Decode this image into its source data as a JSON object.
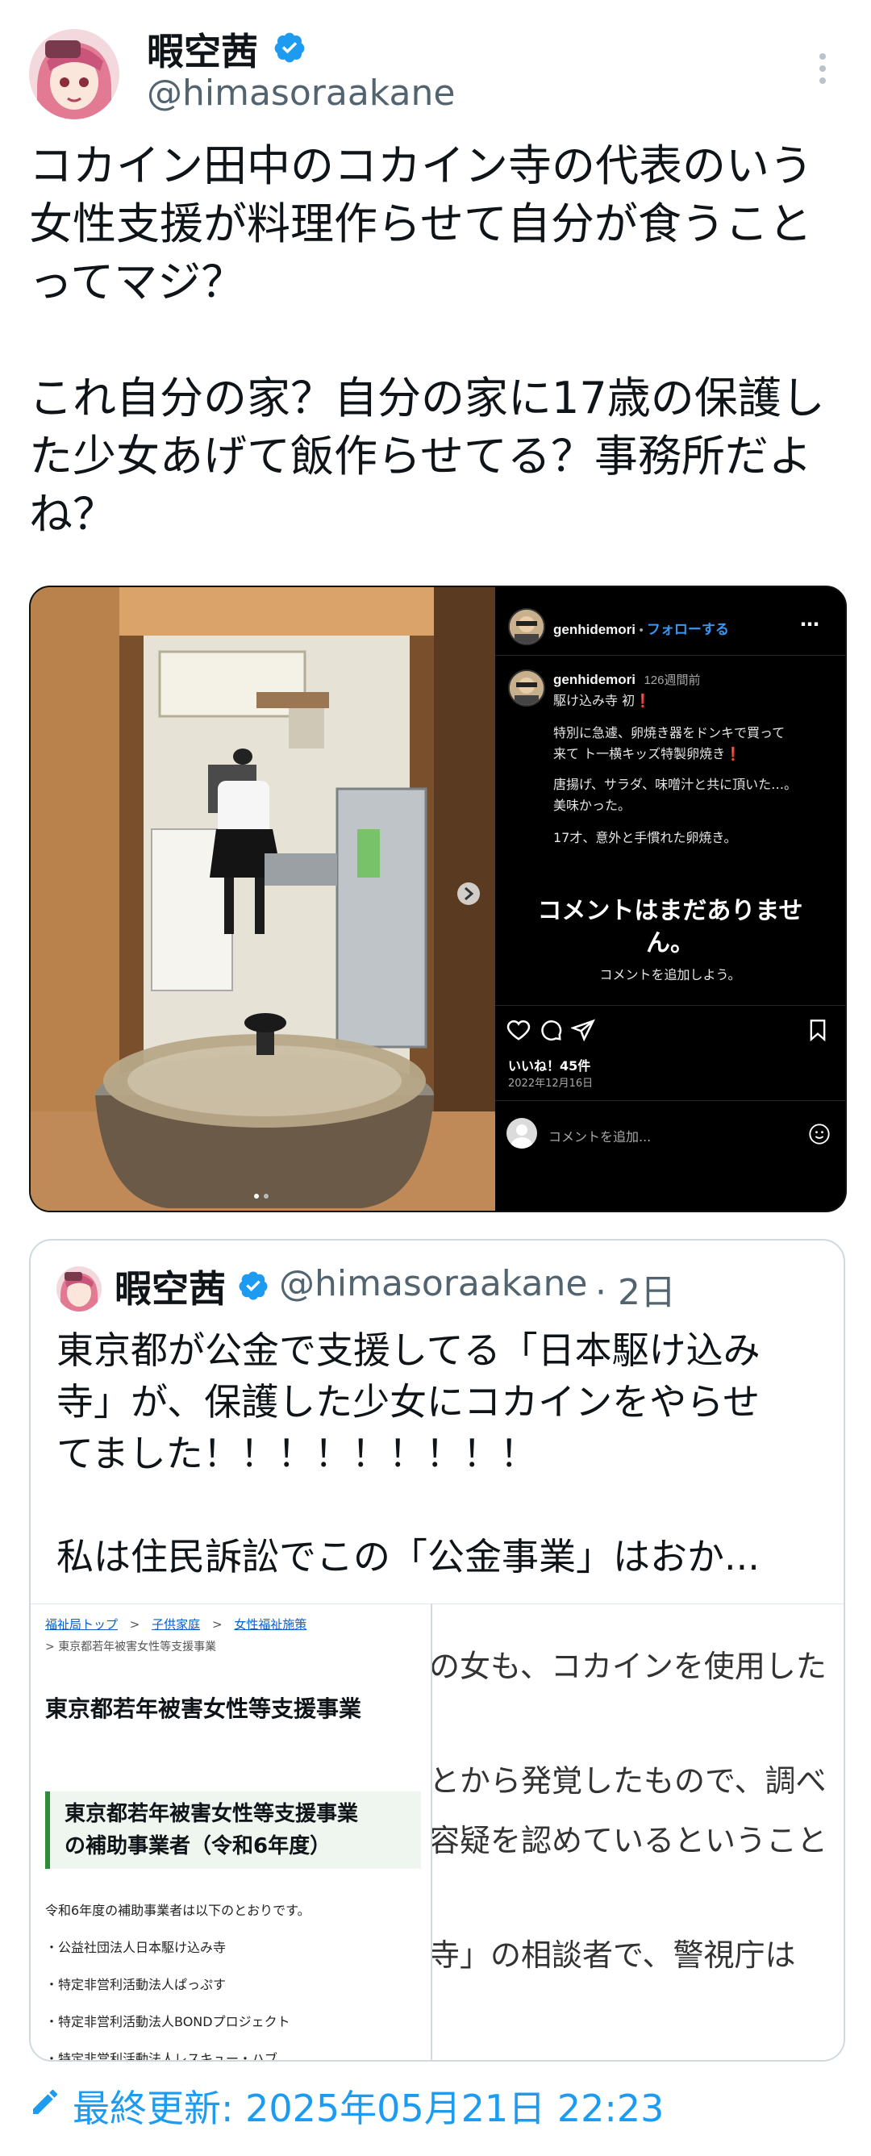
{
  "tweet": {
    "author_name": "暇空茜",
    "author_handle": "@himasoraakane",
    "text": "コカイン田中のコカイン寺の代表のいう\n女性支援が料理作らせて自分が食うこと\nってマジ？\n\nこれ自分の家？自分の家に17歳の保護し\nた少女あげて飯作らせてる？事務所だよ\nね？"
  },
  "instagram": {
    "username": "genhidemori",
    "follow_label": "フォローする",
    "post_username": "genhidemori",
    "post_age": "126週間前",
    "caption_lines": [
      "駆け込み寺 初❗️",
      "特別に急遽、卵焼き器をドンキで買って\n来て ト一横キッズ特製卵焼き❗️",
      "唐揚げ、サラダ、味噌汁と共に頂いた…。\n美味かった。",
      "17才、意外と手慣れた卵焼き。"
    ],
    "no_comments": "コメントはまだありませ\nん。",
    "add_comment_hint": "コメントを追加しよう。",
    "likes": "いいね！45件",
    "date": "2022年12月16日",
    "comment_placeholder": "コメントを追加..."
  },
  "quote": {
    "author_name": "暇空茜",
    "author_handle": "@himasoraakane",
    "age": "· 2日",
    "text": "東京都が公金で支援してる「日本駆け込み\n寺」が、保護した少女にコカインをやらせ\nてました！！！！！！！！！\n\n私は住民訴訟でこの「公金事業」はおか...",
    "page": {
      "breadcrumb": [
        "福祉局トップ",
        "子供家庭",
        "女性福祉施策"
      ],
      "sub_breadcrumb": "東京都若年被害女性等支援事業",
      "title": "東京都若年被害女性等支援事業",
      "section_title": "東京都若年被害女性等支援事業\nの補助事業者（令和6年度）",
      "intro": "令和6年度の補助事業者は以下のとおりです。",
      "list": [
        "・公益社団法人日本駆け込み寺",
        "・特定非営利活動法人ぱっぷす",
        "・特定非営利活動法人BONDプロジェクト",
        "・特定非営利活動法人レスキュー・ハブ"
      ]
    },
    "article_lines": [
      "の女も、コカインを使用した",
      "とから発覚したもので、調べ",
      "容疑を認めているということ",
      "寺」の相談者で、警視庁は"
    ]
  },
  "footer": {
    "updated": "最終更新: 2025年05月21日 22:23"
  },
  "colors": {
    "accent": "#1d9bf0",
    "secondary_text": "#536471",
    "instagram_link": "#3897f0"
  }
}
